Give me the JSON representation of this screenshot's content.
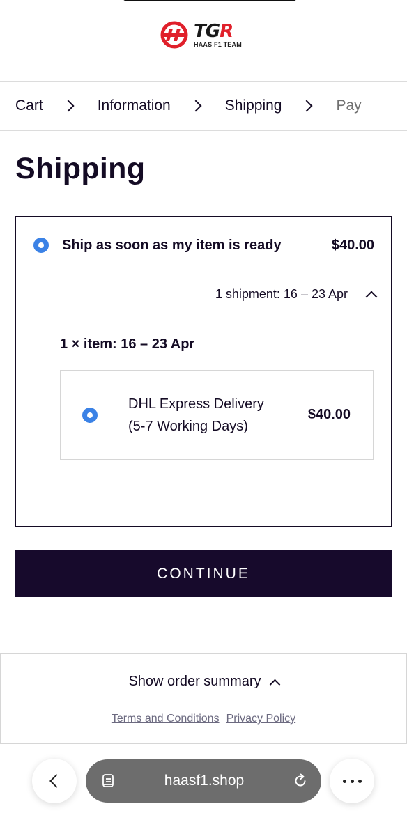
{
  "brand": {
    "name_black": "TG",
    "name_red": "R",
    "subtitle": "HAAS F1 TEAM"
  },
  "breadcrumb": {
    "items": [
      "Cart",
      "Information",
      "Shipping",
      "Pay"
    ]
  },
  "page": {
    "title": "Shipping"
  },
  "shipping_option": {
    "label": "Ship as soon as my item is ready",
    "price": "$40.00",
    "selected": true,
    "shipment_summary": "1 shipment: 16 – 23 Apr",
    "item_heading": "1 × item: 16 – 23 Apr",
    "method": {
      "name_line1": "DHL Express Delivery",
      "name_line2": "(5-7 Working Days)",
      "price": "$40.00",
      "selected": true
    }
  },
  "actions": {
    "continue_label": "CONTINUE"
  },
  "order_summary": {
    "toggle_label": "Show order summary",
    "terms_label": "Terms and Conditions",
    "privacy_label": "Privacy Policy"
  },
  "browser": {
    "url": "haasf1.shop"
  },
  "colors": {
    "primary": "#170a2c",
    "radio": "#3b82e6",
    "brand_red": "#e0202b"
  }
}
